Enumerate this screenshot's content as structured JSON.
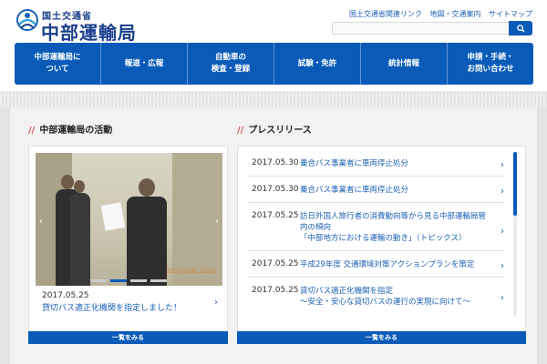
{
  "header": {
    "logo_sub": "国土交通省",
    "logo_main": "中部運輸局",
    "top_links": [
      "国土交通省関連リンク",
      "地図・交通案内",
      "サイトマップ"
    ],
    "search_placeholder": ""
  },
  "nav": {
    "items": [
      {
        "label": "中部運輸局に\nついて"
      },
      {
        "label": "報道・広報"
      },
      {
        "label": "自動車の\n検査・登録"
      },
      {
        "label": "試験・免許"
      },
      {
        "label": "統計情報"
      },
      {
        "label": "申請・手続・\nお問い合わせ"
      }
    ]
  },
  "activities": {
    "title": "中部運輸局の活動",
    "photo_date": "2017/05/25 11:03",
    "news_date": "2017.05.25",
    "news_text": "貸切バス適正化機関を指定しました！",
    "more_label": "一覧をみる"
  },
  "press": {
    "title": "プレスリリース",
    "more_label": "一覧をみる",
    "items": [
      {
        "date": "2017.05.30",
        "text": "乗合バス事業者に車両停止処分"
      },
      {
        "date": "2017.05.30",
        "text": "乗合バス事業者に車両停止処分"
      },
      {
        "date": "2017.05.25",
        "text": "訪日外国人旅行者の消費動向等から見る中部運輸局管\n内の傾向\n「中部地方における運輸の動き」（トピックス）"
      },
      {
        "date": "2017.05.25",
        "text": "平成29年度 交通環境対策アクションプランを策定"
      },
      {
        "date": "2017.05.25",
        "text": "貸切バス適正化機関を指定\n～安全・安心な貸切バスの運行の実現に向けて～"
      }
    ]
  },
  "colors": {
    "brand_blue": "#0a5bb8",
    "accent_red": "#d9534f"
  }
}
